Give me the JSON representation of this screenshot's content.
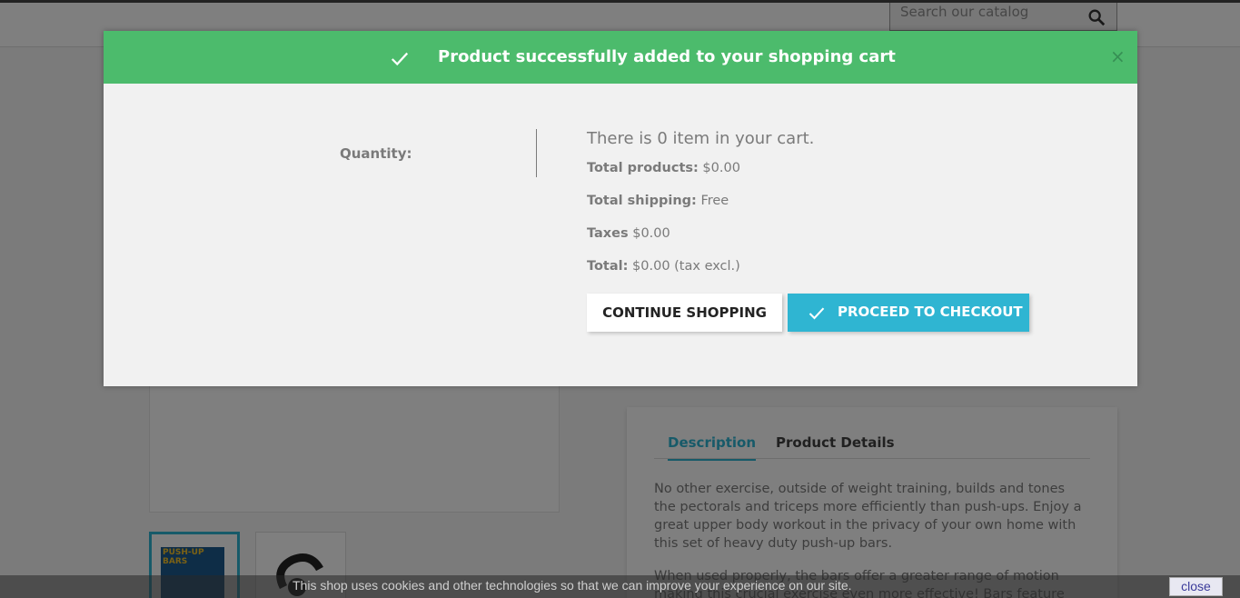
{
  "header": {
    "search_placeholder": "Search our catalog",
    "search_icon": "search-icon"
  },
  "product": {
    "thumbnail_label": "PUSH-UP BARS",
    "tabs": [
      {
        "label": "Description",
        "active": true
      },
      {
        "label": "Product Details",
        "active": false
      }
    ],
    "description_p1": "No other exercise, outside of weight training, builds and tones the pectorals and triceps more efficiently than push-ups. Enjoy a great upper body workout in the privacy of your own home with this set of heavy duty push-up bars.",
    "description_p2": "When used properly, the bars offer a greater range of motion making this crucial exercise even more effective! Bars feature"
  },
  "modal": {
    "title": "Product successfully added to your shopping cart",
    "title_icon": "check-icon",
    "close_label": "×",
    "quantity_label": "Quantity:",
    "cart_count_text": "There is 0 item in your cart.",
    "total_products_label": "Total products:",
    "total_products_value": "$0.00",
    "total_shipping_label": "Total shipping:",
    "total_shipping_value": "Free",
    "taxes_label": "Taxes",
    "taxes_value": "$0.00",
    "total_label": "Total:",
    "total_value": "$0.00 (tax excl.)",
    "continue_button": "CONTINUE SHOPPING",
    "checkout_button": "PROCEED TO CHECKOUT"
  },
  "cookie": {
    "message": "This shop uses cookies and other technologies so that we can improve your experience on our site.",
    "close_button": "close"
  },
  "colors": {
    "success_green": "#4cbb6c",
    "accent_blue": "#2fb5d2"
  }
}
